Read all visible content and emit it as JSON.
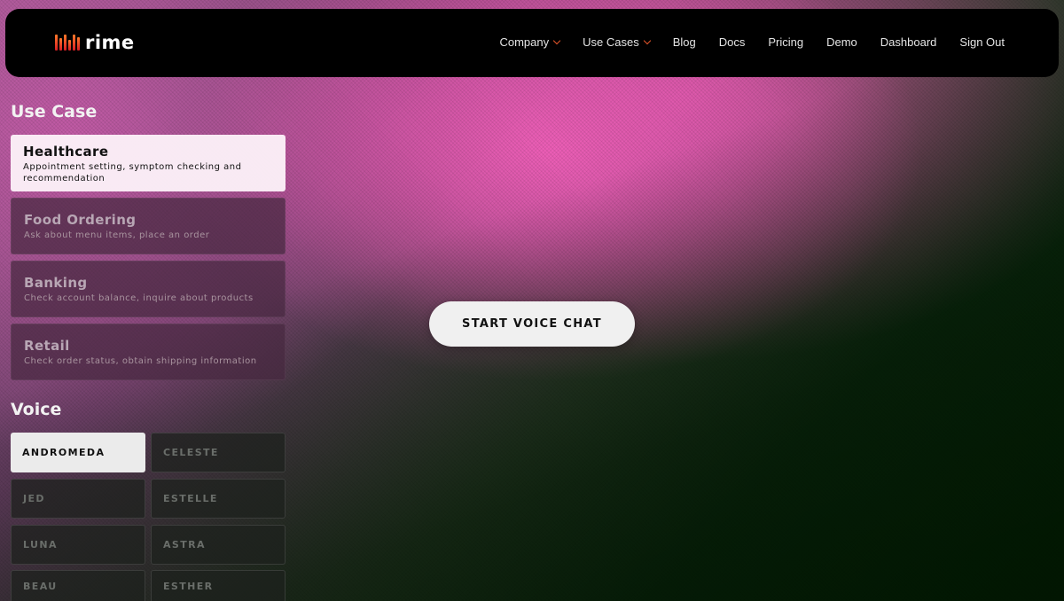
{
  "brand": {
    "name": "rime"
  },
  "nav": {
    "items": [
      {
        "label": "Company",
        "dropdown": true
      },
      {
        "label": "Use Cases",
        "dropdown": true
      },
      {
        "label": "Blog",
        "dropdown": false
      },
      {
        "label": "Docs",
        "dropdown": false
      },
      {
        "label": "Pricing",
        "dropdown": false
      },
      {
        "label": "Demo",
        "dropdown": false
      },
      {
        "label": "Dashboard",
        "dropdown": false
      },
      {
        "label": "Sign Out",
        "dropdown": false
      }
    ]
  },
  "use_case": {
    "heading": "Use Case",
    "items": [
      {
        "title": "Healthcare",
        "description": "Appointment setting, symptom checking and recommendation",
        "selected": true
      },
      {
        "title": "Food Ordering",
        "description": "Ask about menu items, place an order",
        "selected": false
      },
      {
        "title": "Banking",
        "description": "Check account balance, inquire about products",
        "selected": false
      },
      {
        "title": "Retail",
        "description": "Check order status, obtain shipping information",
        "selected": false
      }
    ]
  },
  "voice": {
    "heading": "Voice",
    "items": [
      {
        "label": "ANDROMEDA",
        "selected": true
      },
      {
        "label": "CELESTE",
        "selected": false
      },
      {
        "label": "JED",
        "selected": false
      },
      {
        "label": "ESTELLE",
        "selected": false
      },
      {
        "label": "LUNA",
        "selected": false
      },
      {
        "label": "ASTRA",
        "selected": false
      },
      {
        "label": "BEAU",
        "selected": false
      },
      {
        "label": "ESTHER",
        "selected": false
      }
    ]
  },
  "main": {
    "start_button_label": "START VOICE CHAT"
  },
  "colors": {
    "accent_chevron": "#e2552a",
    "navbar_bg": "#000000",
    "pink_glow": "#f05fb9",
    "dark_green": "#062406"
  }
}
